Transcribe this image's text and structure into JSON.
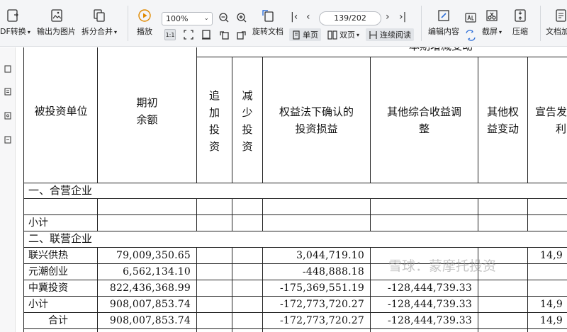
{
  "toolbar": {
    "pdf_convert": "DF转换",
    "export_image": "输出为图片",
    "split_merge": "拆分合并",
    "play": "播放",
    "zoom_value": "100%",
    "page_indicator": "139/202",
    "rotate_doc": "旋转文档",
    "single_page": "单页",
    "double_page": "双页",
    "continuous": "连续阅读",
    "edit_content": "编辑内容",
    "screenshot": "截屏",
    "compress": "压缩",
    "doc_add": "文档加"
  },
  "table": {
    "top_banner": "本期增减变动",
    "headers": {
      "investee": "被投资单位",
      "opening_1": "期初",
      "opening_2": "余额",
      "add_1": "追",
      "add_2": "加",
      "add_3": "投",
      "add_4": "资",
      "reduce_1": "减",
      "reduce_2": "少",
      "reduce_3": "投",
      "reduce_4": "资",
      "equity_gain_1": "权益法下确认的",
      "equity_gain_2": "投资损益",
      "oci_1": "其他综合收益调",
      "oci_2": "整",
      "other_equity_1": "其他权",
      "other_equity_2": "益变动",
      "dividend_1": "宣告发",
      "dividend_2": "利"
    },
    "section_joint": "一、合营企业",
    "subtotal_label": "小计",
    "section_assoc": "二、联营企业",
    "rows": [
      {
        "name": "联兴供热",
        "opening": "79,009,350.65",
        "equity_gain": "3,044,719.10",
        "oci": "",
        "dividend": "14,9"
      },
      {
        "name": "元潮创业",
        "opening": "6,562,134.10",
        "equity_gain": "-448,888.18",
        "oci": "",
        "dividend": ""
      },
      {
        "name": "中冀投资",
        "opening": "822,436,368.99",
        "equity_gain": "-175,369,551.19",
        "oci": "-128,444,739.33",
        "dividend": ""
      },
      {
        "name": "小计",
        "opening": "908,007,853.74",
        "equity_gain": "-172,773,720.27",
        "oci": "-128,444,739.33",
        "dividend": "14,9"
      },
      {
        "name": "合计",
        "opening": "908,007,853.74",
        "equity_gain": "-172,773,720.27",
        "oci": "-128,444,739.33",
        "dividend": "14,9"
      }
    ]
  },
  "watermark": "雪球：蒙摩托投资"
}
